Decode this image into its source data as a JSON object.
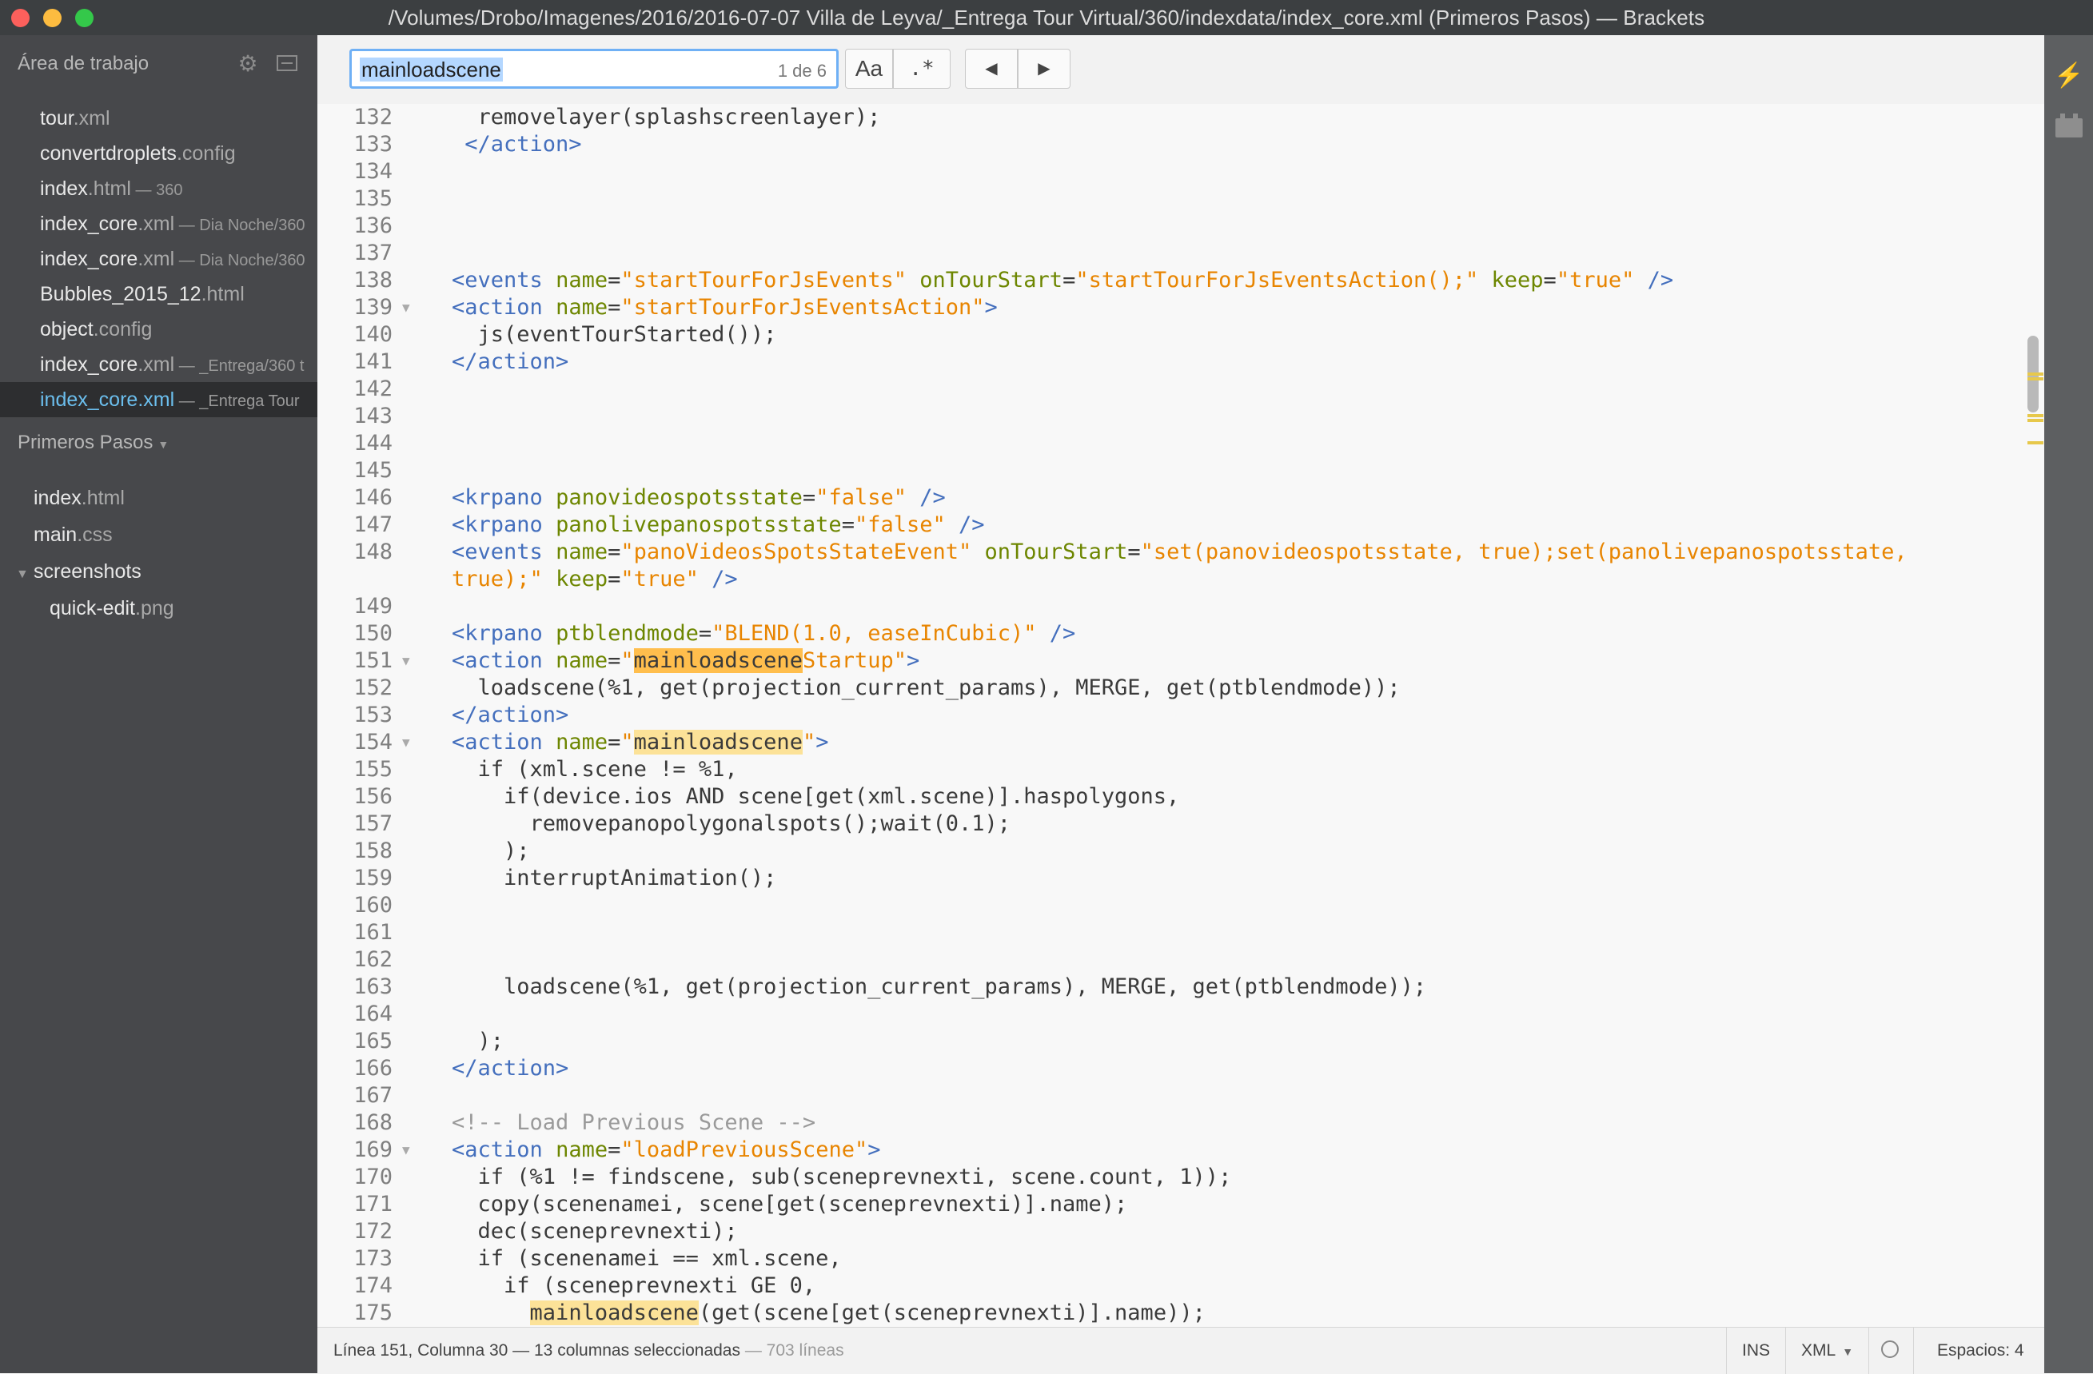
{
  "window": {
    "title": "/Volumes/Drobo/Imagenes/2016/2016-07-07 Villa de Leyva/_Entrega Tour Virtual/360/indexdata/index_core.xml (Primeros Pasos) — Brackets"
  },
  "sidebar": {
    "working_set_title": "Área de trabajo",
    "working_set": [
      {
        "name": "tour",
        "ext": ".xml",
        "dir": ""
      },
      {
        "name": "convertdroplets",
        "ext": ".config",
        "dir": ""
      },
      {
        "name": "index",
        "ext": ".html",
        "dir": " — 360"
      },
      {
        "name": "index_core",
        "ext": ".xml",
        "dir": " — Dia Noche/360"
      },
      {
        "name": "index_core",
        "ext": ".xml",
        "dir": " — Dia Noche/360"
      },
      {
        "name": "Bubbles_2015_12",
        "ext": ".html",
        "dir": ""
      },
      {
        "name": "object",
        "ext": ".config",
        "dir": ""
      },
      {
        "name": "index_core",
        "ext": ".xml",
        "dir": " — _Entrega/360 t"
      },
      {
        "name": "index_core",
        "ext": ".xml",
        "dir": " — _Entrega Tour"
      }
    ],
    "project_title": "Primeros Pasos",
    "project_files": [
      {
        "name": "index",
        "ext": ".html"
      },
      {
        "name": "main",
        "ext": ".css"
      }
    ],
    "folder": "screenshots",
    "folder_files": [
      {
        "name": "quick-edit",
        "ext": ".png"
      }
    ]
  },
  "findbar": {
    "query": "mainloadscene",
    "match_count": "1 de 6",
    "case_button": "Aa",
    "regex_button": ".*",
    "prev_button": "◀",
    "next_button": "▶"
  },
  "editor": {
    "line_numbers": [
      "132",
      "133",
      "134",
      "135",
      "136",
      "137",
      "138",
      "139",
      "140",
      "141",
      "142",
      "143",
      "144",
      "145",
      "146",
      "147",
      "148",
      "",
      "149",
      "150",
      "151",
      "152",
      "153",
      "154",
      "155",
      "156",
      "157",
      "158",
      "159",
      "160",
      "161",
      "162",
      "163",
      "164",
      "165",
      "166",
      "167",
      "168",
      "169",
      "170",
      "171",
      "172",
      "173",
      "174",
      "175"
    ]
  },
  "statusbar": {
    "cursor": "Línea 151, Columna 30 — 13 columnas seleccionadas",
    "lines": " — 703 líneas",
    "mode": "INS",
    "language": "XML",
    "indent_label": "Espacios:",
    "indent_value": "4"
  },
  "colors": {
    "tag": "#446fbd",
    "attribute": "#6d8600",
    "string": "#e88501",
    "comment": "#9a9a9a",
    "match_highlight": "#fce298",
    "current_match": "#ffbe4d",
    "sidebar_bg": "#47484b",
    "active_file": "#6bbeed"
  }
}
